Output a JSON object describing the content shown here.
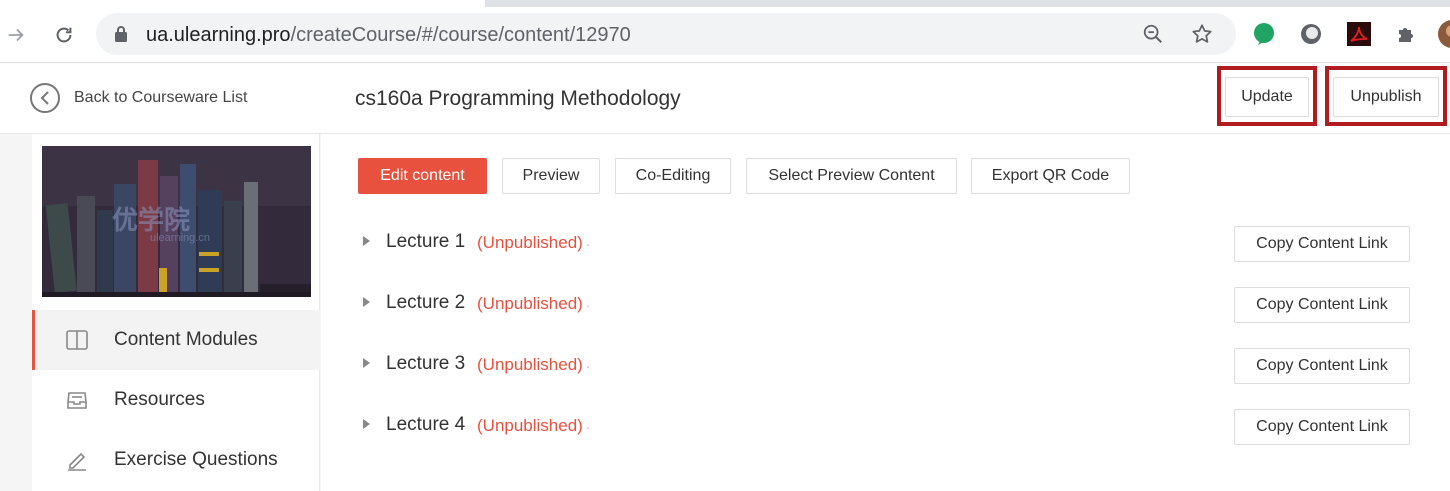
{
  "browser": {
    "url_host": "ua.ulearning.pro",
    "url_path": "/createCourse/#/course/content/12970"
  },
  "header": {
    "back_label": "Back to Courseware List",
    "course_title": "cs160a Programming Methodology",
    "update_label": "Update",
    "unpublish_label": "Unpublish"
  },
  "sidebar": {
    "cover_watermark": "优学院",
    "cover_watermark_sub": "ulearning.cn",
    "items": [
      {
        "label": "Content Modules",
        "icon": "book-icon",
        "active": true
      },
      {
        "label": "Resources",
        "icon": "inbox-icon",
        "active": false
      },
      {
        "label": "Exercise Questions",
        "icon": "pencil-icon",
        "active": false
      }
    ]
  },
  "toolbar": {
    "edit_content": "Edit content",
    "preview": "Preview",
    "co_editing": "Co-Editing",
    "select_preview": "Select Preview Content",
    "export_qr": "Export QR Code"
  },
  "lectures": [
    {
      "name": "Lecture 1",
      "status": "(Unpublished)",
      "copy_label": "Copy Content Link"
    },
    {
      "name": "Lecture 2",
      "status": "(Unpublished)",
      "copy_label": "Copy Content Link"
    },
    {
      "name": "Lecture 3",
      "status": "(Unpublished)",
      "copy_label": "Copy Content Link"
    },
    {
      "name": "Lecture 4",
      "status": "(Unpublished)",
      "copy_label": "Copy Content Link"
    }
  ],
  "colors": {
    "accent": "#e8513e",
    "highlight_border": "#b01c20"
  }
}
